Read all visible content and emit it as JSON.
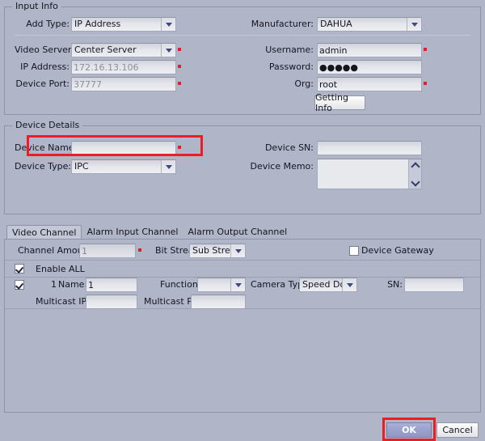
{
  "dialog": {
    "sections": {
      "input_info": "Input Info",
      "device_details": "Device Details"
    }
  },
  "input_info": {
    "add_type": {
      "label": "Add Type:",
      "value": "IP Address"
    },
    "manufacturer": {
      "label": "Manufacturer:",
      "value": "DAHUA"
    },
    "video_server": {
      "label": "Video Server:",
      "value": "Center Server"
    },
    "ip_address": {
      "label": "IP Address:",
      "value": "172.16.13.106"
    },
    "device_port": {
      "label": "Device Port:",
      "value": "37777"
    },
    "username": {
      "label": "Username:",
      "value": "admin"
    },
    "password": {
      "label": "Password:",
      "value": "●●●●●"
    },
    "org": {
      "label": "Org:",
      "value": "root"
    },
    "getting_info_button": "Getting Info"
  },
  "device_details": {
    "device_name": {
      "label": "Device Name:",
      "value": "",
      "placeholder": ""
    },
    "device_type": {
      "label": "Device Type:",
      "value": "IPC"
    },
    "device_sn": {
      "label": "Device SN:",
      "value": ""
    },
    "device_memo": {
      "label": "Device Memo:",
      "value": ""
    }
  },
  "channel_panel": {
    "tabs": [
      {
        "label": "Video Channel",
        "active": true
      },
      {
        "label": "Alarm Input Channel",
        "active": false
      },
      {
        "label": "Alarm Output Channel",
        "active": false
      }
    ],
    "channel_amount": {
      "label": "Channel Amount:",
      "value": "1"
    },
    "bit_stream": {
      "label": "Bit Stream:",
      "value": "Sub Stream"
    },
    "device_gateway": {
      "label": "Device Gateway",
      "checked": false
    },
    "enable_all": {
      "label": "Enable ALL",
      "checked": true
    },
    "row": {
      "index": "1",
      "checked": true,
      "name_label": "Name:",
      "name_value": "1",
      "function_label": "Function:",
      "function_value": "",
      "camera_type_label": "Camera Type:",
      "camera_type_value": "Speed Dome",
      "sn_label": "SN:",
      "sn_value": "",
      "multicast_ip_label": "Multicast IP:",
      "multicast_ip_value": "",
      "multicast_port_label": "Multicast Port:",
      "multicast_port_value": ""
    }
  },
  "footer": {
    "ok": "OK",
    "cancel": "Cancel"
  },
  "colors": {
    "background": "#b0b5c8",
    "accent_highlight": "#ee1c24",
    "required_marker": "#d8232a",
    "primary_button": "#9aa1cd"
  }
}
